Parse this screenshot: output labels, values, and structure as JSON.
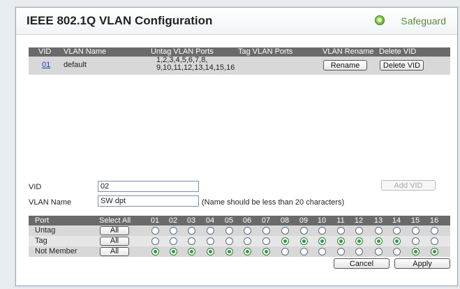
{
  "title": "IEEE 802.1Q VLAN Configuration",
  "brand": "Safeguard",
  "vlan_table": {
    "headers": [
      "VID",
      "VLAN Name",
      "Untag VLAN Ports",
      "Tag VLAN Ports",
      "VLAN Rename",
      "Delete VID"
    ],
    "rows": [
      {
        "vid": "01",
        "name": "default",
        "untag_line1": "1,2,3,4,5,6,7,8,",
        "untag_line2": "9,10,11,12,13,14,15,16",
        "tag": "",
        "rename_label": "Rename",
        "delete_label": "Delete VID"
      }
    ]
  },
  "form": {
    "vid_label": "VID",
    "vid_value": "02",
    "name_label": "VLAN Name",
    "name_value": "SW dpt",
    "name_hint": "(Name should be less than 20 characters)",
    "add_label": "Add VID"
  },
  "ports": {
    "port_header": "Port",
    "select_all_header": "Select All",
    "numbers": [
      "01",
      "02",
      "03",
      "04",
      "05",
      "06",
      "07",
      "08",
      "09",
      "10",
      "11",
      "12",
      "13",
      "14",
      "15",
      "16"
    ],
    "all_label": "All",
    "rows": [
      {
        "label": "Untag",
        "selected": []
      },
      {
        "label": "Tag",
        "selected": [
          8,
          9,
          10,
          11,
          12,
          13,
          14
        ]
      },
      {
        "label": "Not Member",
        "selected": [
          1,
          2,
          3,
          4,
          5,
          6,
          7,
          15,
          16
        ]
      }
    ]
  },
  "buttons": {
    "cancel": "Cancel",
    "apply": "Apply"
  },
  "colors": {
    "brand_green": "#5a8a3c",
    "header_gray": "#6a6a6a",
    "link_blue": "#1a3fb0",
    "radio_on": "#2a9d3a"
  }
}
